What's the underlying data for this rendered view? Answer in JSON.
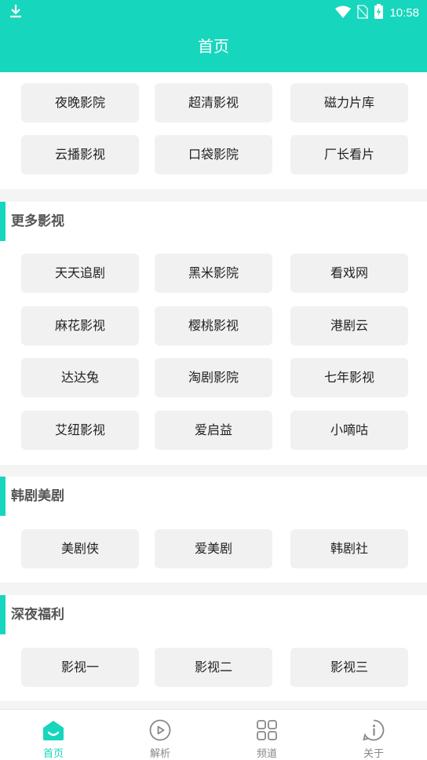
{
  "status_bar": {
    "time": "10:58",
    "icons": [
      "download-icon",
      "wifi-icon",
      "no-sim-icon",
      "battery-charging-icon"
    ]
  },
  "header": {
    "title": "首页"
  },
  "sections": [
    {
      "items": [
        "夜晚影院",
        "超清影视",
        "磁力片库",
        "云播影视",
        "口袋影院",
        "厂长看片"
      ]
    },
    {
      "title": "更多影视",
      "items": [
        "天天追剧",
        "黑米影院",
        "看戏网",
        "麻花影视",
        "樱桃影视",
        "港剧云",
        "达达兔",
        "淘剧影院",
        "七年影视",
        "艾纽影视",
        "爱启益",
        "小嘀咕"
      ]
    },
    {
      "title": "韩剧美剧",
      "items": [
        "美剧侠",
        "爱美剧",
        "韩剧社"
      ]
    },
    {
      "title": "深夜福利",
      "items": [
        "影视一",
        "影视二",
        "影视三"
      ]
    }
  ],
  "tab_bar": {
    "tabs": [
      {
        "label": "首页",
        "icon": "home-icon",
        "active": true
      },
      {
        "label": "解析",
        "icon": "play-circle-icon",
        "active": false
      },
      {
        "label": "频道",
        "icon": "grid-icon",
        "active": false
      },
      {
        "label": "关于",
        "icon": "info-icon",
        "active": false
      }
    ],
    "active_color": "#16d6bd"
  },
  "colors": {
    "accent": "#16d6bd",
    "background": "#f4f4f4"
  }
}
